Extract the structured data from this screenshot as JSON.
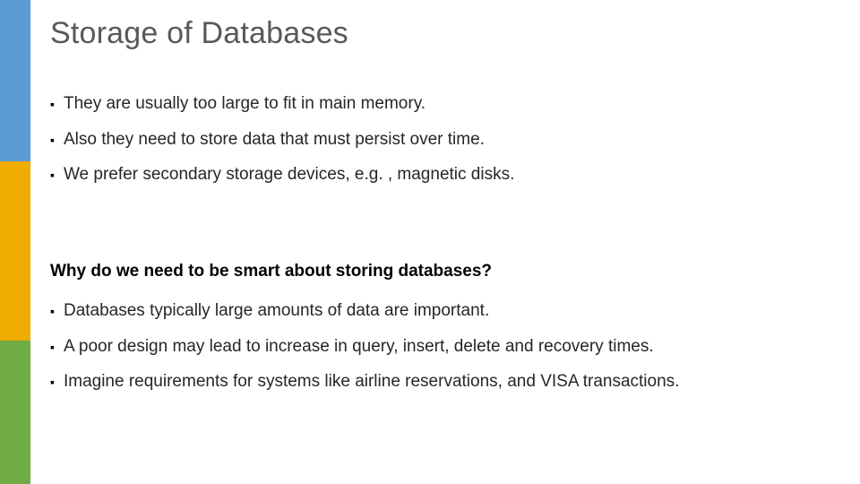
{
  "title": "Storage of Databases",
  "bullets_a": [
    "They are usually too large to fit in main memory.",
    "Also they need to store data that must persist over time.",
    "We prefer secondary storage devices, e.g. , magnetic disks."
  ],
  "subheading": "Why do we need to be smart about storing databases?",
  "bullets_b": [
    "Databases typically large amounts of data are important.",
    "A poor design may lead to increase in query, insert, delete and recovery times.",
    "Imagine requirements for systems like airline reservations, and VISA transactions."
  ],
  "colors": {
    "blue": "#5b9bd5",
    "yellow": "#f0ab00",
    "green": "#70ad47",
    "title": "#595959"
  }
}
